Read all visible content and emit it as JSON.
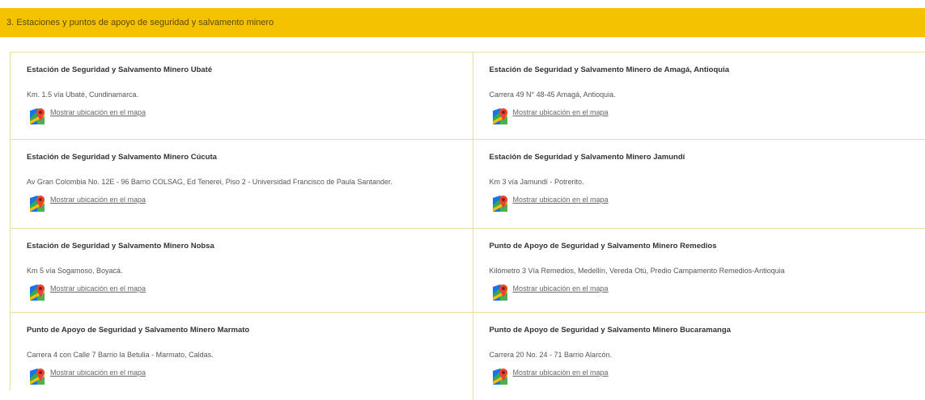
{
  "section": {
    "title": "3. Estaciones y puntos de apoyo de seguridad y salvamento minero"
  },
  "map_link_label": "Mostrar ubicación en el mapa",
  "colors": {
    "accent": "#f5c200",
    "border": "#f0dca0"
  },
  "icons": {
    "map": "google-maps-icon"
  },
  "stations": [
    {
      "name": "Estación de Seguridad y Salvamento Minero Ubaté",
      "address": "Km. 1.5 vía Ubaté, Cundinamarca."
    },
    {
      "name": "Estación de Seguridad y Salvamento Minero de Amagá, Antioquia",
      "address": "Carrera 49 N° 48-45 Amagá, Antioquia."
    },
    {
      "name": "Estación de Seguridad y Salvamento Minero Cúcuta",
      "address": "Av Gran Colombia No. 12E - 96 Barrio COLSAG, Ed Tenerei, Piso 2 - Universidad Francisco de Paula Santander."
    },
    {
      "name": "Estación de Seguridad y Salvamento Minero Jamundí",
      "address": "Km 3 vía Jamundí - Potrerito."
    },
    {
      "name": "Estación de Seguridad y Salvamento Minero Nobsa",
      "address": "Km 5 vía Sogamoso, Boyacá."
    },
    {
      "name": "Punto de Apoyo de Seguridad y Salvamento Minero Remedios",
      "address": "Kilómetro 3 Vía Remedios, Medellín, Vereda Otú, Predio Campamento Remedios-Antioquia"
    },
    {
      "name": "Punto de Apoyo de Seguridad y Salvamento Minero Marmato",
      "address": "Carrera 4 con Calle 7 Barrio la Betulia - Marmato, Caldas."
    },
    {
      "name": "Punto de Apoyo de Seguridad y Salvamento Minero Bucaramanga",
      "address": "Carrera 20 No. 24 - 71 Barrio Alarcón."
    }
  ]
}
